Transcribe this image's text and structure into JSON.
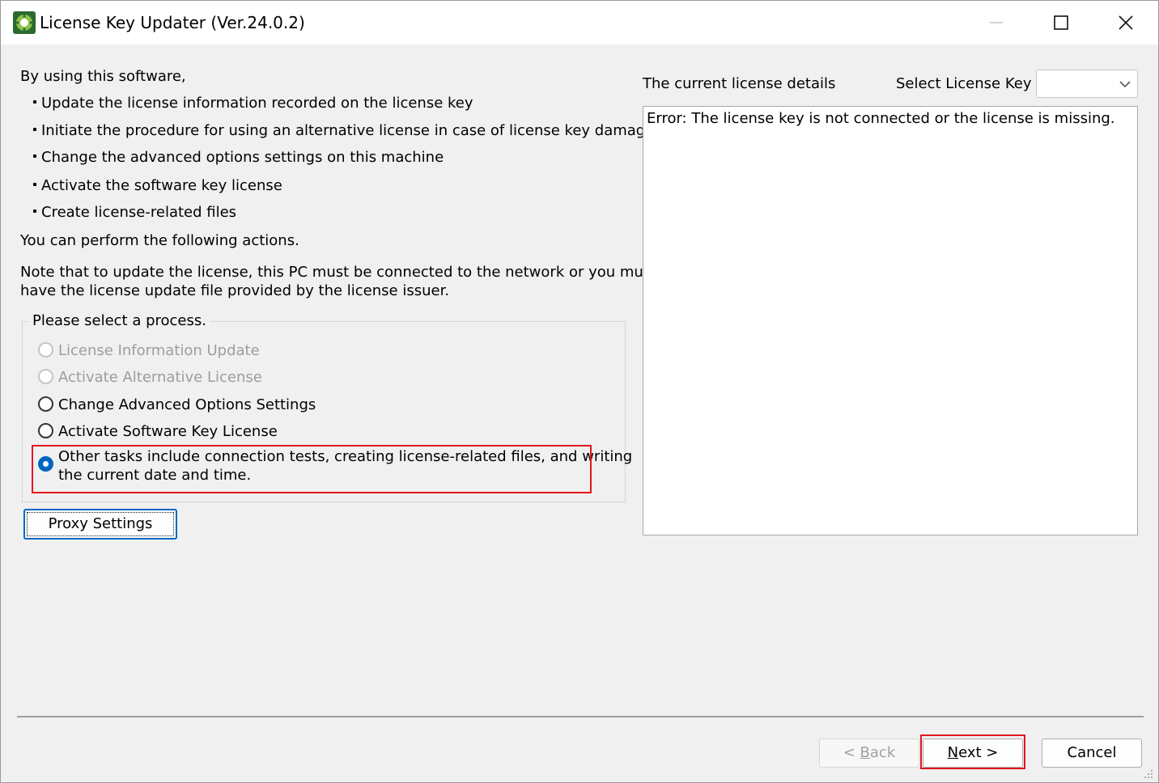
{
  "window": {
    "title": "License Key Updater (Ver.24.0.2)",
    "icon": "app-green-gear-icon"
  },
  "intro": {
    "heading": "By using this software,",
    "bullets": [
      "Update the license information recorded on the license key",
      "Initiate the procedure for using an alternative license in case of license key damage",
      "Change the advanced options settings on this machine",
      "Activate the software key license",
      "Create license-related files"
    ],
    "actions_text": "You can perform the following actions.",
    "note_line1": "Note that to update the license, this PC must be connected to the network or you must",
    "note_line2": "have the license update file provided by the license issuer."
  },
  "process": {
    "group_title": "Please select a process.",
    "options": [
      {
        "label": "License Information Update",
        "enabled": false,
        "selected": false
      },
      {
        "label": "Activate Alternative License",
        "enabled": false,
        "selected": false
      },
      {
        "label": "Change Advanced Options Settings",
        "enabled": true,
        "selected": false
      },
      {
        "label": "Activate Software Key License",
        "enabled": true,
        "selected": false
      },
      {
        "label_line1": "Other tasks include connection tests, creating license-related files, and writing",
        "label_line2": "the current date and time.",
        "enabled": true,
        "selected": true
      }
    ]
  },
  "proxy_button": "Proxy Settings",
  "details": {
    "label": "The current license details",
    "select_label": "Select License Key",
    "select_value": "",
    "text": "Error: The license key is not connected or the license is missing."
  },
  "footer": {
    "back": {
      "pre": "< ",
      "accel": "B",
      "post": "ack"
    },
    "next": {
      "accel": "N",
      "post": "ext >"
    },
    "cancel": "Cancel"
  },
  "colors": {
    "accent": "#0067c0",
    "highlight": "#e3161e"
  }
}
